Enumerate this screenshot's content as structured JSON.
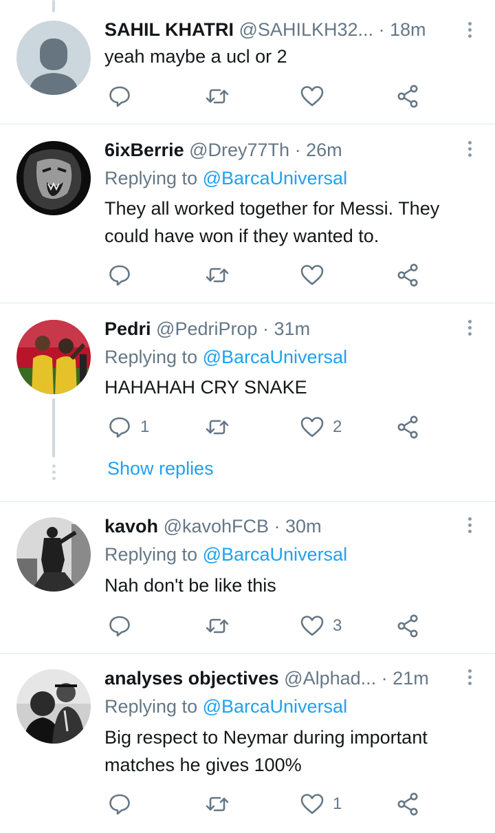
{
  "icons": {
    "reply": "speech-bubble",
    "retweet": "retweet-arrows",
    "like": "heart",
    "share": "share-nodes",
    "menu": "vertical-ellipsis"
  },
  "colors": {
    "link": "#1da1f2",
    "secondary": "#657786",
    "divider": "#e1e8ed"
  },
  "tweets": [
    {
      "name": "SAHIL KHATRI",
      "handle": "@SAHILKH32...",
      "sep": " · ",
      "time": "18m",
      "text": "yeah maybe a ucl or 2",
      "reply_count": "",
      "retweet_count": "",
      "like_count": ""
    },
    {
      "name": "6ixBerrie",
      "handle": "@Drey77Th",
      "sep": " · ",
      "time": "26m",
      "replying_prefix": "Replying to ",
      "replying_target": "@BarcaUniversal",
      "text": "They all worked together for Messi. They could have won if they wanted to.",
      "reply_count": "",
      "retweet_count": "",
      "like_count": ""
    },
    {
      "name": "Pedri",
      "handle": "@PedriProp",
      "sep": " · ",
      "time": "31m",
      "replying_prefix": "Replying to ",
      "replying_target": "@BarcaUniversal",
      "text": "HAHAHAH CRY SNAKE",
      "reply_count": "1",
      "retweet_count": "",
      "like_count": "2",
      "show_replies": "Show replies"
    },
    {
      "name": "kavoh",
      "handle": "@kavohFCB",
      "sep": " · ",
      "time": "30m",
      "replying_prefix": "Replying to ",
      "replying_target": "@BarcaUniversal",
      "text": "Nah don't be like this",
      "reply_count": "",
      "retweet_count": "",
      "like_count": "3"
    },
    {
      "name": "analyses objectives",
      "handle": "@Alphad...",
      "sep": " · ",
      "time": "21m",
      "replying_prefix": "Replying to ",
      "replying_target": "@BarcaUniversal",
      "text": "Big respect to Neymar during important matches he gives 100%",
      "reply_count": "",
      "retweet_count": "",
      "like_count": "1"
    }
  ]
}
